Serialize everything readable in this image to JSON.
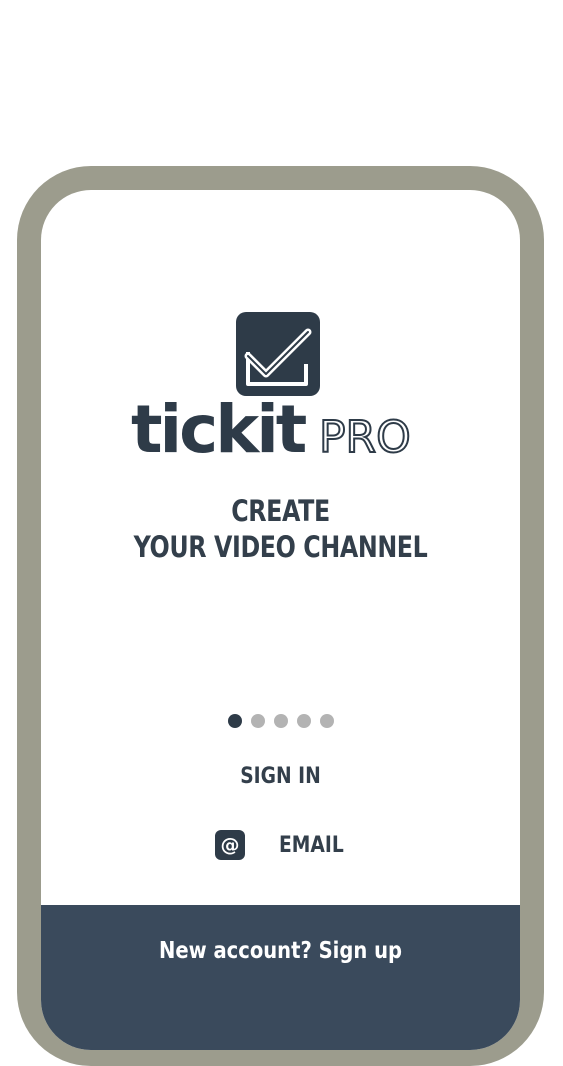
{
  "app": {
    "brand_main": "tickit",
    "brand_suffix": "PRO"
  },
  "onboarding": {
    "headline_line1": "CREATE",
    "headline_line2": "YOUR VIDEO CHANNEL",
    "pager": {
      "total": 5,
      "active_index": 0
    }
  },
  "auth": {
    "sign_in_label": "SIGN IN",
    "email_icon_glyph": "@",
    "email_label": "EMAIL",
    "signup_label": "New account? Sign up"
  },
  "colors": {
    "frame": "#9c9c8d",
    "brand_dark": "#2e3b48",
    "bottom_bar": "#3a4a5c",
    "dot_inactive": "#b3b3b3"
  },
  "icons": {
    "logo": "checkbox-check-icon",
    "email": "at-sign-icon"
  }
}
